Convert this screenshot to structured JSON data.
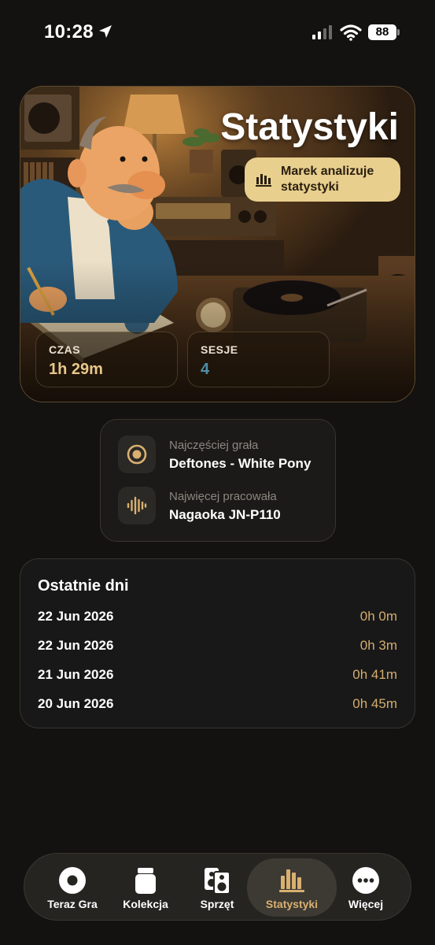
{
  "status_bar": {
    "time": "10:28",
    "battery": "88"
  },
  "hero": {
    "title": "Statystyki",
    "pill_label": "Marek analizuje statystyki",
    "stats": [
      {
        "label": "CZAS",
        "value": "1h 29m"
      },
      {
        "label": "SESJE",
        "value": "4"
      }
    ]
  },
  "facts": {
    "most_played_label": "Najczęściej grała",
    "most_played_value": "Deftones - White Pony",
    "most_worked_label": "Najwięcej pracowała",
    "most_worked_value": "Nagaoka JN-P110"
  },
  "recent": {
    "title": "Ostatnie dni",
    "days": [
      {
        "date": "22 Jun 2026",
        "duration": "0h 0m"
      },
      {
        "date": "22 Jun 2026",
        "duration": "0h 3m"
      },
      {
        "date": "21 Jun 2026",
        "duration": "0h 41m"
      },
      {
        "date": "20 Jun 2026",
        "duration": "0h 45m"
      }
    ]
  },
  "tabs": [
    {
      "label": "Teraz Gra",
      "icon": "record-icon",
      "active": false
    },
    {
      "label": "Kolekcja",
      "icon": "jar-icon",
      "active": false
    },
    {
      "label": "Sprzęt",
      "icon": "speakers-icon",
      "active": false
    },
    {
      "label": "Statystyki",
      "icon": "bar-chart-icon",
      "active": true
    },
    {
      "label": "Więcej",
      "icon": "more-icon",
      "active": false
    }
  ],
  "colors": {
    "accent": "#d9b070",
    "pill_bg": "#e8cf8e",
    "duration": "#d4ad6e",
    "sessions": "#4f8fa8"
  }
}
